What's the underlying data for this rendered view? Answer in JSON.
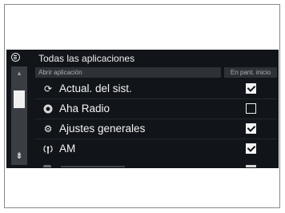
{
  "header": {
    "title": "Todas las aplicaciones",
    "menu_icon": "menu-icon"
  },
  "columns": {
    "left": "Abrir aplicación",
    "right": "En pant. inicio"
  },
  "items": [
    {
      "label": "Actual. del sist.",
      "icon": "refresh-icon",
      "checked": true
    },
    {
      "label": "Aha Radio",
      "icon": "aha-radio-icon",
      "checked": false
    },
    {
      "label": "Ajustes generales",
      "icon": "gear-icon",
      "checked": true
    },
    {
      "label": "AM",
      "icon": "antenna-icon",
      "checked": true
    }
  ],
  "scrollbar": {
    "up_icon": "scroll-up-icon",
    "down_icon": "scroll-down-icon"
  }
}
